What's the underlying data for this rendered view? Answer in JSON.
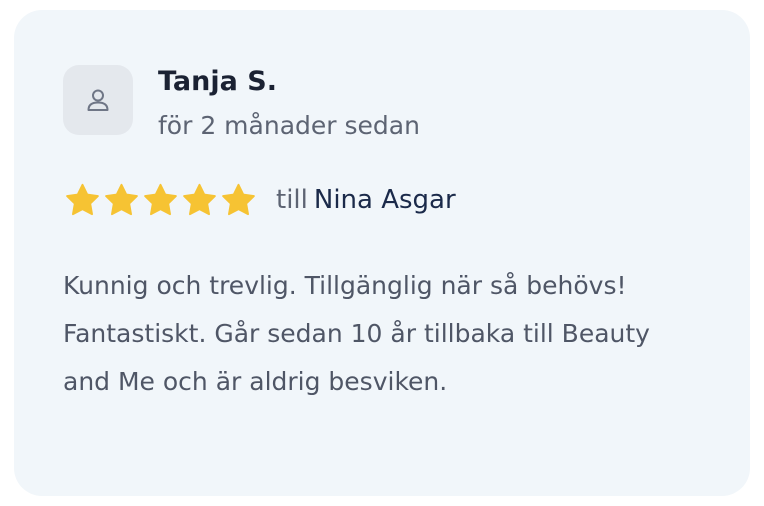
{
  "review": {
    "author": "Tanja S.",
    "posted_ago": "för 2 månader sedan",
    "rating": 5,
    "rating_max": 5,
    "recipient_prefix": "till",
    "recipient_name": "Nina Asgar",
    "text": "Kunnig och trevlig. Tillgänglig när så behövs! Fantastiskt. Går sedan 10 år tillbaka till Beauty and Me och är aldrig besviken.",
    "avatar_icon": "user-icon"
  },
  "colors": {
    "card_background": "#f1f6fa",
    "star": "#f6c333",
    "author": "#1b2233",
    "recipient": "#1b2a4a",
    "muted_text": "#5d6473"
  }
}
